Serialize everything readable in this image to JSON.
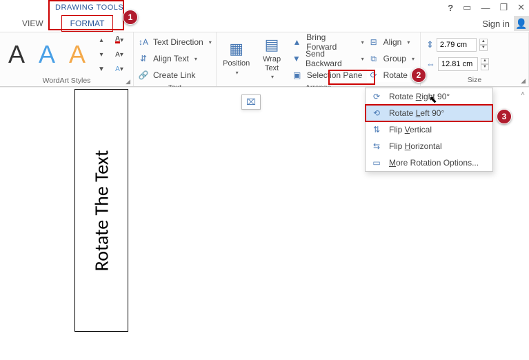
{
  "titlebar": {
    "contextual_label": "DRAWING TOOLS",
    "help": "?",
    "ribbon_opts": "▭",
    "minimize": "—",
    "restore": "❐",
    "close": "✕"
  },
  "tabs": {
    "view": "VIEW",
    "format": "FORMAT",
    "signin": "Sign in"
  },
  "groups": {
    "wordart": "WordArt Styles",
    "text": "Text",
    "arrange": "Arrange",
    "size": "Size"
  },
  "wordart_sample": "A",
  "text_cmds": {
    "direction": "Text Direction",
    "align": "Align Text",
    "link": "Create Link"
  },
  "big": {
    "position": "Position",
    "wrap": "Wrap\nText"
  },
  "arrange_cmds": {
    "forward": "Bring Forward",
    "backward": "Send Backward",
    "selection": "Selection Pane",
    "align": "Align",
    "group": "Group",
    "rotate": "Rotate"
  },
  "size": {
    "height": "2.79 cm",
    "width": "12.81 cm"
  },
  "menu": {
    "right": "Rotate Right 90°",
    "left": "Rotate Left 90°",
    "flipv": "Flip Vertical",
    "fliph": "Flip Horizontal",
    "more": "More Rotation Options..."
  },
  "document": {
    "textbox_content": "Rotate The Text"
  },
  "callouts": {
    "one": "1",
    "two": "2",
    "three": "3"
  }
}
